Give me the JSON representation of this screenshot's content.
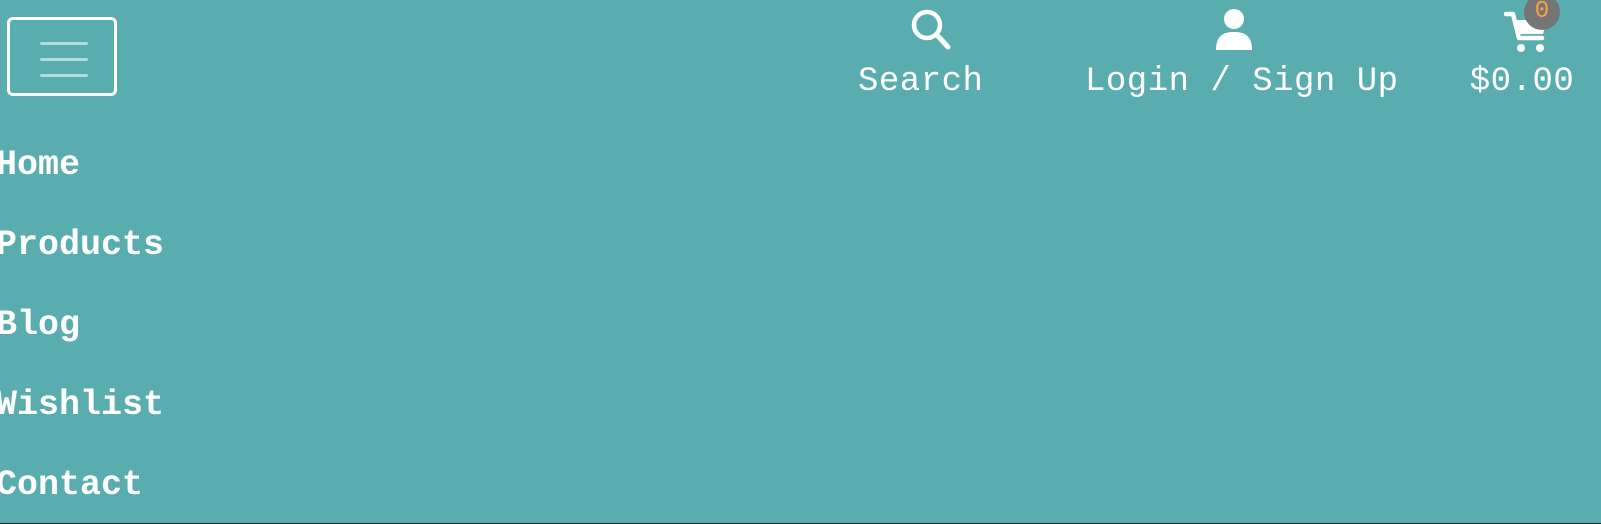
{
  "header": {
    "menu_toggle_icon": "hamburger-menu-icon",
    "search": {
      "label": "Search",
      "icon": "search-icon"
    },
    "account": {
      "label": "Login / Sign Up",
      "icon": "user-icon"
    },
    "cart": {
      "total": "$0.00",
      "count": "0",
      "icon": "shopping-cart-icon"
    }
  },
  "nav": {
    "items": [
      {
        "label": "Home"
      },
      {
        "label": "Products"
      },
      {
        "label": "Blog"
      },
      {
        "label": "Wishlist"
      },
      {
        "label": "Contact"
      }
    ]
  },
  "colors": {
    "background": "#5aadaf",
    "text": "#ffffff",
    "badge_bg": "#757575",
    "badge_text": "#f5a442"
  }
}
